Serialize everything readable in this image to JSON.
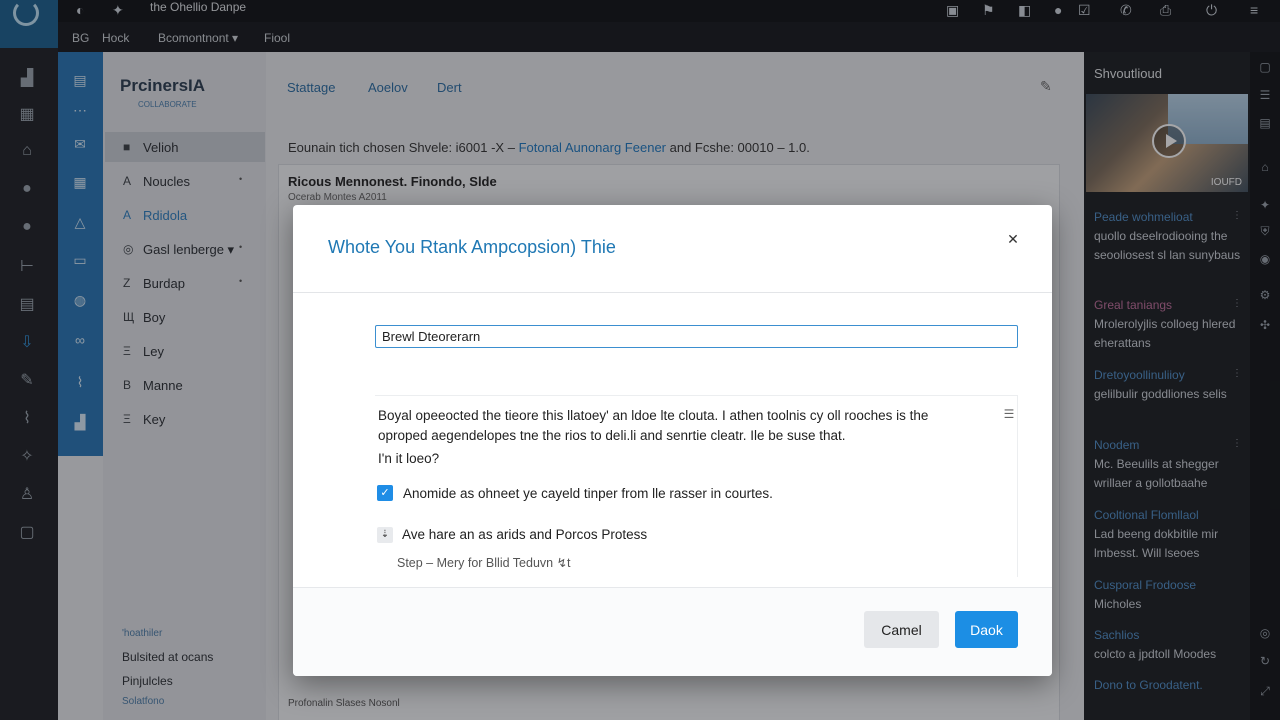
{
  "window": {
    "title": "the Ohellio Danpe"
  },
  "menubar": {
    "items": [
      "BG",
      "Hock",
      "Bcomontnont ▾",
      "Fiool"
    ]
  },
  "app": {
    "brand": "PrcinersIA",
    "brand_sub": "COLLABORATE",
    "tabs": [
      "Stattage",
      "Aoelov",
      "Dert"
    ]
  },
  "nav": {
    "items": [
      {
        "icon": "■",
        "label": "Velioh",
        "chevron": ""
      },
      {
        "icon": "A",
        "label": "Noucles",
        "chevron": "•"
      },
      {
        "icon": "A",
        "label": "Rdidola",
        "chevron": ""
      },
      {
        "icon": "◎",
        "label": "Gasl lenberge ▾",
        "chevron": "•"
      },
      {
        "icon": "Z",
        "label": "Burdap",
        "chevron": "•"
      },
      {
        "icon": "Щ",
        "label": "Boy",
        "chevron": ""
      },
      {
        "icon": "Ξ",
        "label": "Ley",
        "chevron": ""
      },
      {
        "icon": "B",
        "label": "Manne",
        "chevron": ""
      },
      {
        "icon": "Ξ",
        "label": "Key",
        "chevron": ""
      }
    ],
    "footer_small": "'hoathiler",
    "footer_1": "Bulsited at ocans",
    "footer_2": "Pinjulcles",
    "footer_3": "Solatfono"
  },
  "content": {
    "desc_pre": "Eounain tich chosen Shvele: i6001 -X –",
    "desc_link": "Fotonal Aunonarg Feener",
    "desc_post": "and Fcshe: 00010 – 1.0.",
    "card_title": "Ricous Mennonest. Finondo, Slde",
    "card_sub": "Ocerab Montes A2011",
    "bottom_frag": "Profonalin Slases Nosonl"
  },
  "right_panel": {
    "title": "Shvoutlioud",
    "thumb_tag": "IOUFD",
    "sections": [
      {
        "head": "Peade wohmelioat",
        "body": "quollo dseelrodiooing the seooliosest sl lan sunybaus"
      },
      {
        "head": "Greal taniangs",
        "body": "Mrolerolyjlis colloeg hlered eherattans"
      },
      {
        "head": "Dretoyoollinuliioy",
        "body": "gelilbulir goddliones selis"
      },
      {
        "head": "Noodem",
        "body": "Mc. Beeulils at shegger wrillaer a gollotbaahe"
      },
      {
        "head": "Cooltional Flomllaol",
        "body": "Lad beeng dokbitile mir lmbesst. Will lseoes"
      },
      {
        "head": "Cusporal Frodoose",
        "body": "Micholes"
      },
      {
        "head": "Sachlios",
        "body": "colcto a jpdtoll Moodes"
      },
      {
        "head": "Dono to Groodatent.",
        "body": ""
      }
    ]
  },
  "modal": {
    "title": "Whote You Rtank Ampcopsion) Thie",
    "input_value": "Brewl Dteorerarn",
    "input_placeholder": "",
    "body_text": "Boyal opeeocted the tieore this llatoey' an ldoe lte clouta. I athen toolnis cy oll rooches is the oproped aegendelopes tne the rios to deli.li and senrtie cleatr. Ile be suse that.",
    "question": "I'n it loeo?",
    "option_1": "Anomide as ohneet ye cayeld tinper from lle rasser in courtes.",
    "option_2": "Ave hare an as arids and Porcos Protess",
    "step_text": "Step – Mery for Bllid Teduvn ↯t",
    "cancel_label": "Camel",
    "primary_label": "Daok"
  }
}
